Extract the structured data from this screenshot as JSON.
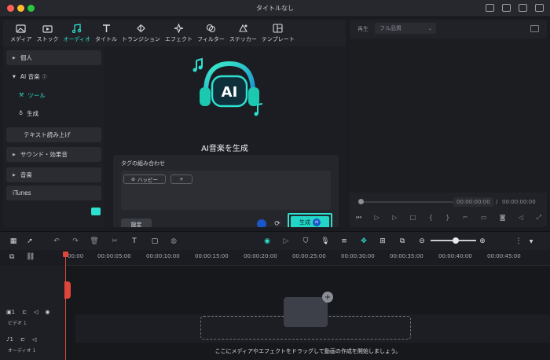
{
  "window": {
    "title": "タイトルなし"
  },
  "tabs": [
    {
      "label": "メディア",
      "icon": "media-icon"
    },
    {
      "label": "ストック",
      "icon": "stock-icon"
    },
    {
      "label": "オーディオ",
      "icon": "music-note-icon",
      "active": true
    },
    {
      "label": "タイトル",
      "icon": "title-t-icon"
    },
    {
      "label": "トランジション",
      "icon": "transition-icon"
    },
    {
      "label": "エフェクト",
      "icon": "effects-icon"
    },
    {
      "label": "フィルター",
      "icon": "filter-icon"
    },
    {
      "label": "ステッカー",
      "icon": "sticker-icon"
    },
    {
      "label": "テンプレート",
      "icon": "template-icon"
    }
  ],
  "sidebar": {
    "personal": "個人",
    "ai_music": "AI 音楽",
    "tool": "ツール",
    "generate": "生成",
    "tts": "テキスト読み上げ",
    "sound_fx": "サウンド・効果音",
    "music": "音楽",
    "itunes": "iTunes"
  },
  "ai_panel": {
    "art_label": "AI",
    "title": "AI音楽を生成",
    "tag_combo_label": "タグの組み合わせ",
    "chip_happy": "ハッピー",
    "chip_add": "+",
    "settings_button": "設定",
    "generate_button": "生成",
    "ai_badge": "AI"
  },
  "preview": {
    "label": "再生",
    "quality": "フル品質",
    "current_time": "00:00:00:00",
    "separator": "/",
    "total_time": "00:00:00:00"
  },
  "timeline": {
    "ruler": [
      "00:00",
      "00:00:05:00",
      "00:00:10:00",
      "00:00:15:00",
      "00:00:20:00",
      "00:00:25:00",
      "00:00:30:00",
      "00:00:35:00",
      "00:00:40:00",
      "00:00:45:00"
    ],
    "video_track_label": "ビデオ 1",
    "audio_track_label": "オーディオ 1",
    "video_track_num": "1",
    "audio_track_num": "1",
    "drop_hint": "ここにメディアやエフェクトをドラッグして動画の作成を開始しましょう。"
  },
  "colors": {
    "accent": "#2de0cf",
    "playhead": "#e0453a",
    "ai_badge": "#1a56c8"
  }
}
